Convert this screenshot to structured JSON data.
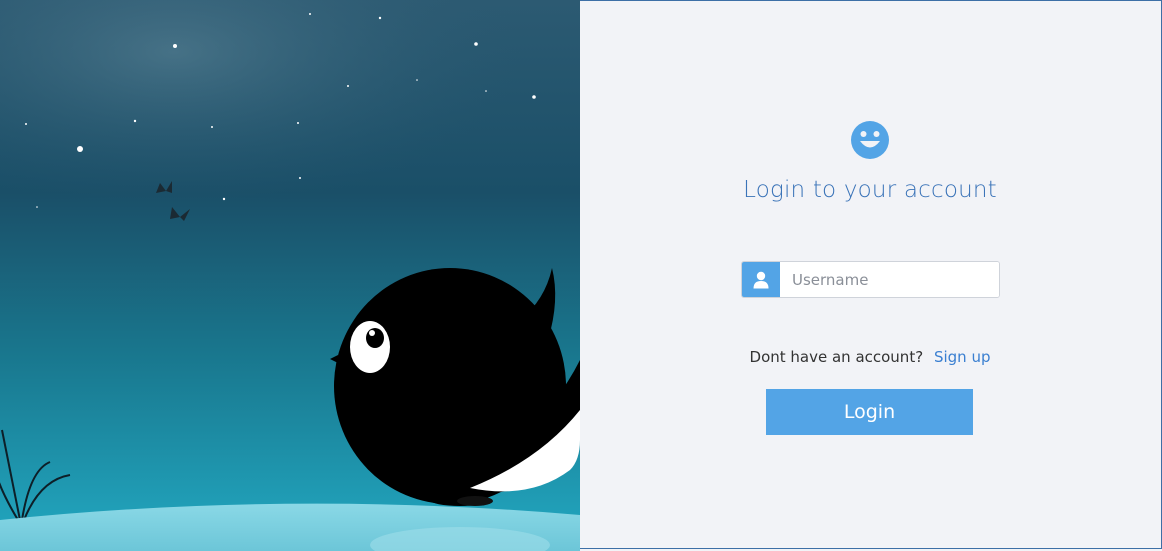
{
  "login": {
    "title": "Login to your account",
    "username_placeholder": "Username",
    "username_value": "",
    "signup_prompt": "Dont have an account?",
    "signup_link": "Sign up",
    "login_button": "Login"
  },
  "colors": {
    "accent": "#53a4e6",
    "title": "#3a73b8",
    "link": "#3a7fd1",
    "panel_bg": "#f2f3f7"
  },
  "icons": {
    "logo": "smiley-face-icon",
    "username_addon": "user-icon"
  }
}
